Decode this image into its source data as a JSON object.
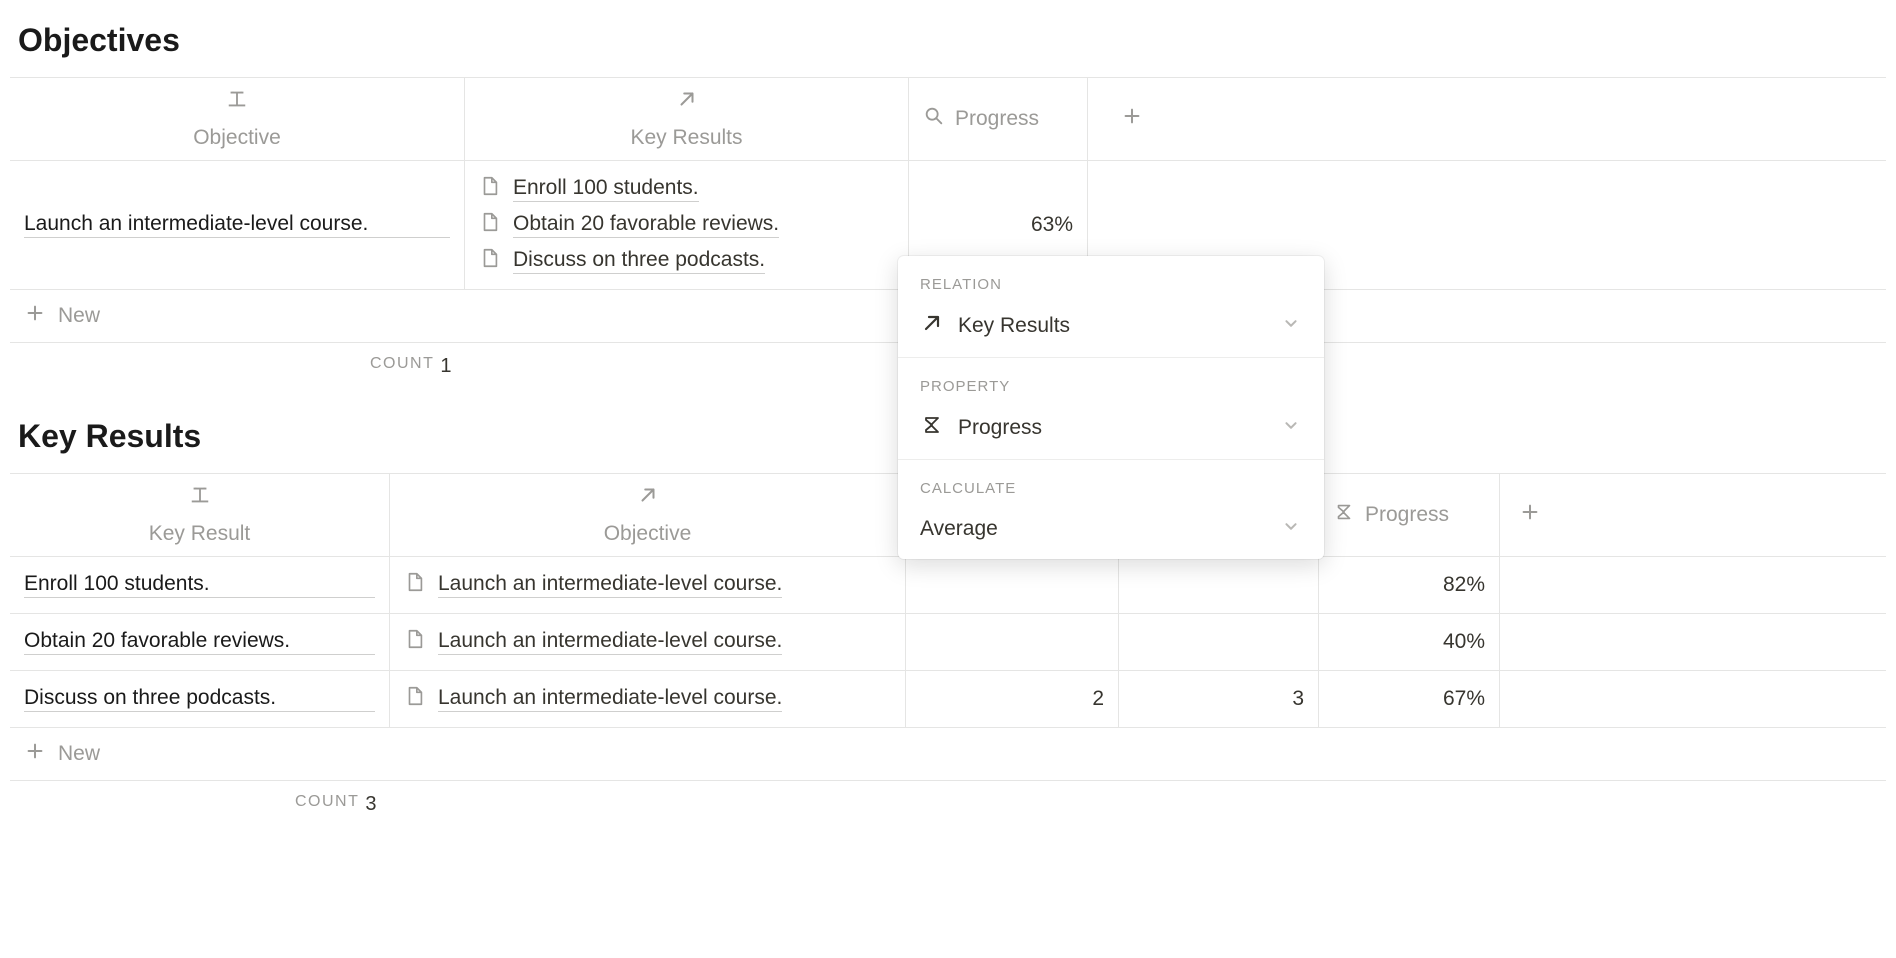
{
  "objectives": {
    "title": "Objectives",
    "columns": {
      "objective": "Objective",
      "key_results": "Key Results",
      "progress": "Progress"
    },
    "new_label": "New",
    "count_label": "COUNT",
    "count_value": "1",
    "rows": [
      {
        "objective": "Launch an intermediate-level course.",
        "key_results": [
          "Enroll 100 students.",
          "Obtain 20 favorable reviews.",
          "Discuss on three podcasts."
        ],
        "progress": "63%"
      }
    ]
  },
  "key_results": {
    "title": "Key Results",
    "columns": {
      "key_result": "Key Result",
      "objective": "Objective",
      "progress": "Progress"
    },
    "new_label": "New",
    "count_label": "COUNT",
    "count_value": "3",
    "rows": [
      {
        "key_result": "Enroll 100 students.",
        "objective": "Launch an intermediate-level course.",
        "num1": "",
        "num2": "",
        "progress": "82%"
      },
      {
        "key_result": "Obtain 20 favorable reviews.",
        "objective": "Launch an intermediate-level course.",
        "num1": "",
        "num2": "",
        "progress": "40%"
      },
      {
        "key_result": "Discuss on three podcasts.",
        "objective": "Launch an intermediate-level course.",
        "num1": "2",
        "num2": "3",
        "progress": "67%"
      }
    ]
  },
  "popover": {
    "relation_label": "RELATION",
    "relation_value": "Key Results",
    "property_label": "PROPERTY",
    "property_value": "Progress",
    "calculate_label": "CALCULATE",
    "calculate_value": "Average"
  }
}
